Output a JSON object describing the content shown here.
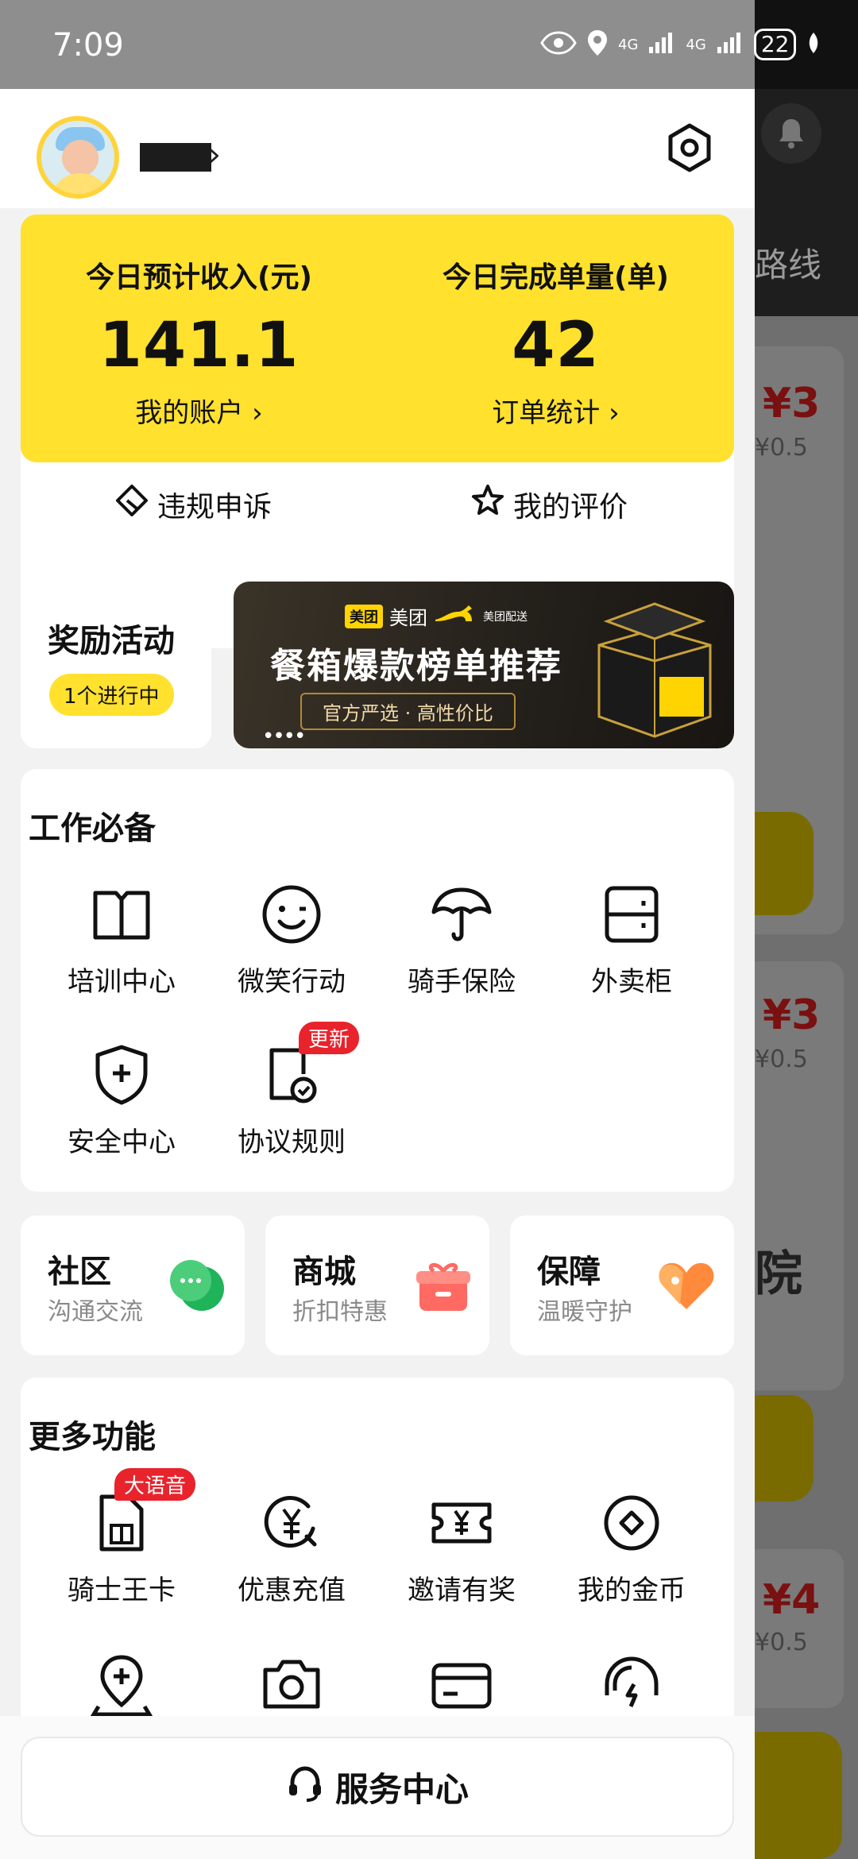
{
  "status_bar": {
    "time": "7:09",
    "signal_label_1": "4G",
    "signal_label_2": "4G",
    "battery": "22"
  },
  "background_app": {
    "route_text": "路线",
    "prices": [
      "¥3",
      "¥3",
      "¥4"
    ],
    "sub_prices": [
      "¥0.5",
      "¥0.5",
      "¥0.5"
    ],
    "yard_text": "院"
  },
  "header": {
    "name_chevron": "›"
  },
  "earnings": {
    "income_label": "今日预计收入(元)",
    "income_value": "141.1",
    "account_link": "我的账户 ›",
    "orders_label": "今日完成单量(单)",
    "orders_value": "42",
    "stats_link": "订单统计 ›"
  },
  "actions": {
    "appeal": "违规申诉",
    "reviews": "我的评价"
  },
  "rewards": {
    "title": "奖励活动",
    "badge": "1个进行中"
  },
  "banner": {
    "brand": "美团",
    "brand_box": "美团",
    "delivery": "美团配送",
    "title": "餐箱爆款榜单推荐",
    "subtitle": "官方严选 · 高性价比",
    "dots": "••••"
  },
  "work": {
    "title": "工作必备",
    "items": [
      "培训中心",
      "微笑行动",
      "骑手保险",
      "外卖柜",
      "安全中心",
      "协议规则"
    ],
    "update_tag": "更新"
  },
  "tiles": [
    {
      "title": "社区",
      "sub": "沟通交流"
    },
    {
      "title": "商城",
      "sub": "折扣特惠"
    },
    {
      "title": "保障",
      "sub": "温暖守护"
    }
  ],
  "more": {
    "title": "更多功能",
    "items": [
      "骑士王卡",
      "优惠充值",
      "邀请有奖",
      "我的金币"
    ],
    "voice_tag": "大语音"
  },
  "service": {
    "label": "服务中心"
  },
  "colors": {
    "brand_yellow": "#ffe12e",
    "badge_red": "#e8232c"
  }
}
